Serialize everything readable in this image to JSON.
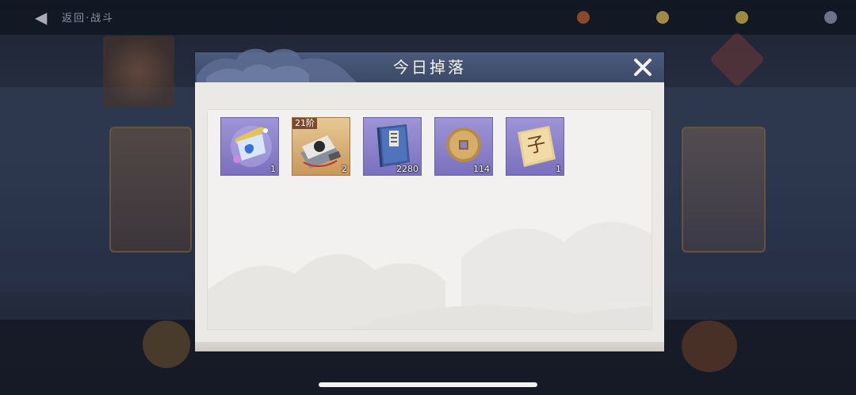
{
  "background": {
    "top_title": "返回·战斗",
    "resources": [
      "",
      "",
      ""
    ]
  },
  "dialog": {
    "title": "今日掉落",
    "close_icon": "close-x-icon",
    "items": [
      {
        "icon": "scroll-artifact-icon",
        "quantity": "1",
        "rarity": "purple",
        "badge": ""
      },
      {
        "icon": "manual-bundle-icon",
        "quantity": "2",
        "rarity": "gold",
        "badge": "21阶"
      },
      {
        "icon": "blue-book-icon",
        "quantity": "2280",
        "rarity": "purple",
        "badge": ""
      },
      {
        "icon": "copper-coin-icon",
        "quantity": "114",
        "rarity": "purple",
        "badge": ""
      },
      {
        "icon": "character-paper-icon",
        "quantity": "1",
        "rarity": "purple",
        "badge": ""
      }
    ]
  },
  "colors": {
    "header": "#44527a",
    "panel": "#ebe9e6",
    "purple_frame": "#8a82c9",
    "gold_frame": "#d4a971"
  }
}
